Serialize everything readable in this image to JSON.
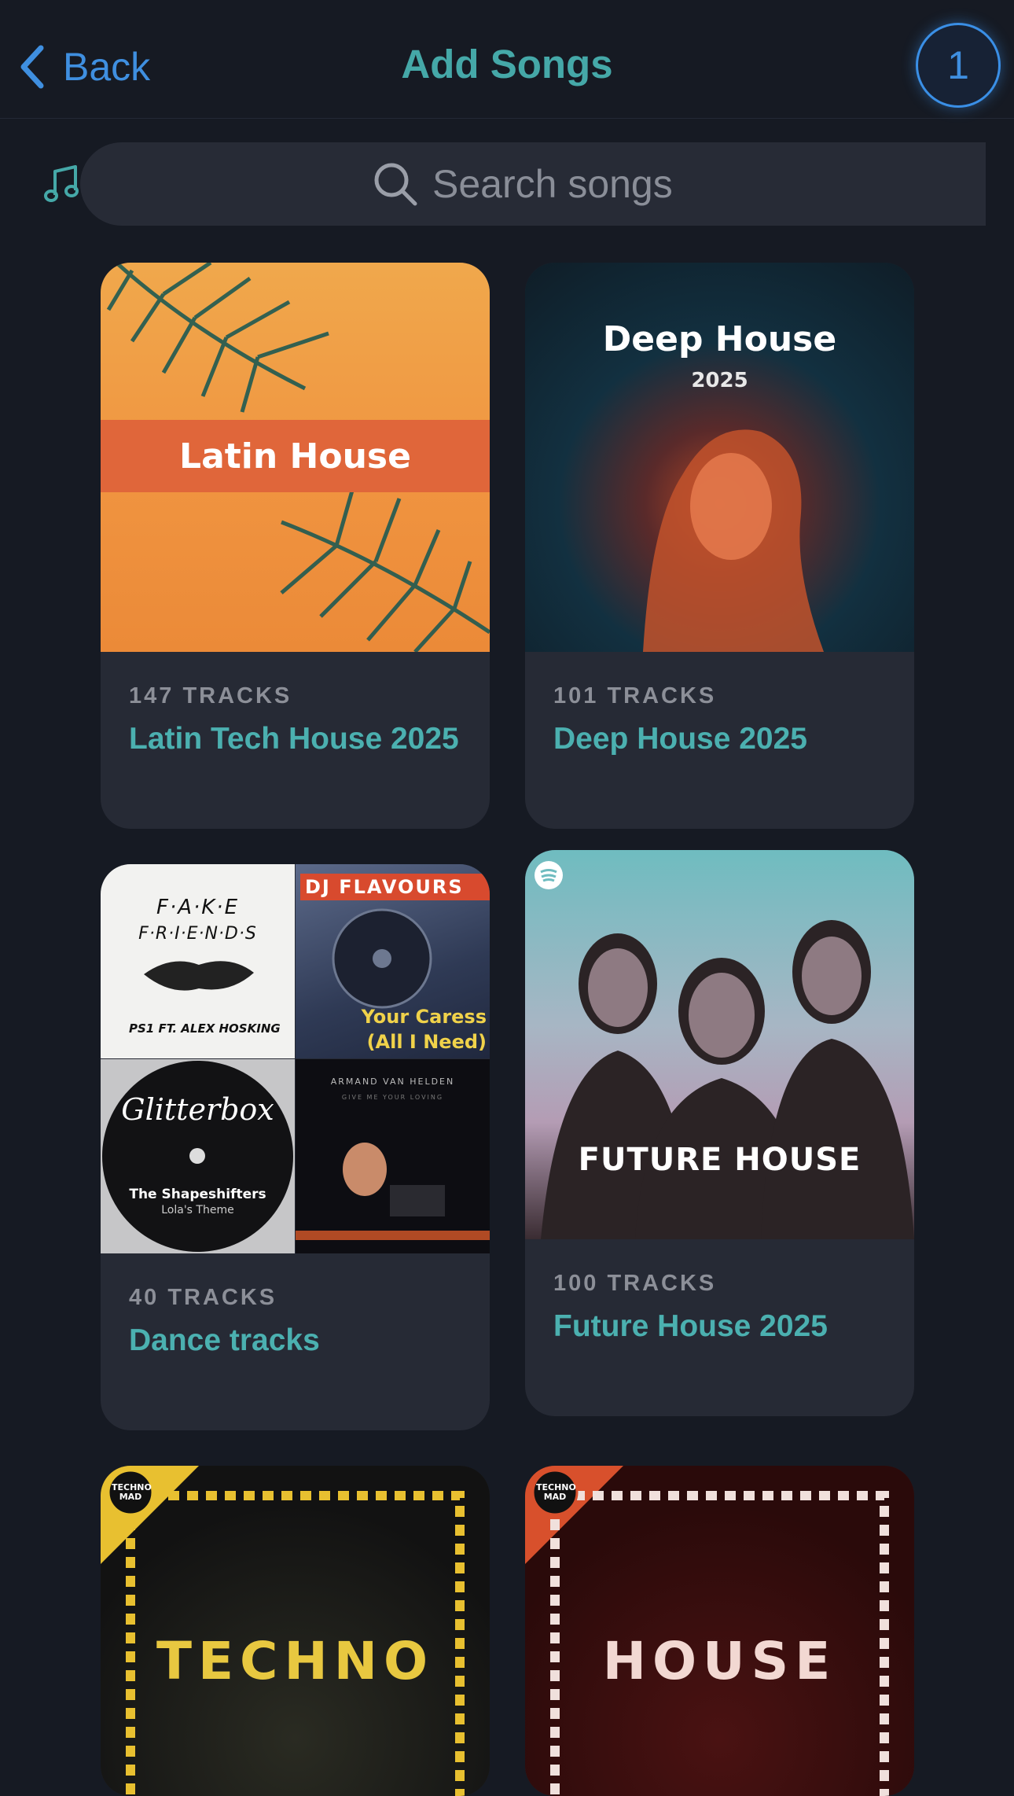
{
  "header": {
    "back_label": "Back",
    "title": "Add Songs",
    "badge_count": "1"
  },
  "search": {
    "placeholder": "Search songs"
  },
  "playlists": [
    {
      "count": "147 TRACKS",
      "name": "Latin Tech House 2025",
      "art_text": "Latin House"
    },
    {
      "count": "101 TRACKS",
      "name": "Deep House 2025",
      "art_title": "Deep House",
      "art_year": "2025"
    },
    {
      "count": "40 TRACKS",
      "name": "Dance tracks",
      "tiles": [
        {
          "line1": "F·A·K·E",
          "line2": "F·R·I·E·N·D·S",
          "line3": "PS1 FT. ALEX HOSKING"
        },
        {
          "line1": "DJ FLAVOURS",
          "line2": "Your Caress",
          "line3": "(All I Need)"
        },
        {
          "line1": "Glitterbox",
          "line2": "The Shapeshifters",
          "line3": "Lola's Theme"
        },
        {
          "line1": "ARMAND VAN HELDEN",
          "line2": "GIVE ME YOUR LOVING"
        }
      ]
    },
    {
      "count": "100 TRACKS",
      "name": "Future House 2025",
      "art_text": "FUTURE HOUSE"
    },
    {
      "art_text": "TECHNO",
      "logo": "TECHNO MAD"
    },
    {
      "art_text": "HOUSE",
      "logo": "TECHNO MAD"
    }
  ],
  "colors": {
    "accent": "#45a8a8",
    "link": "#3f8fe0",
    "background": "#161a23",
    "card": "#262a35"
  }
}
